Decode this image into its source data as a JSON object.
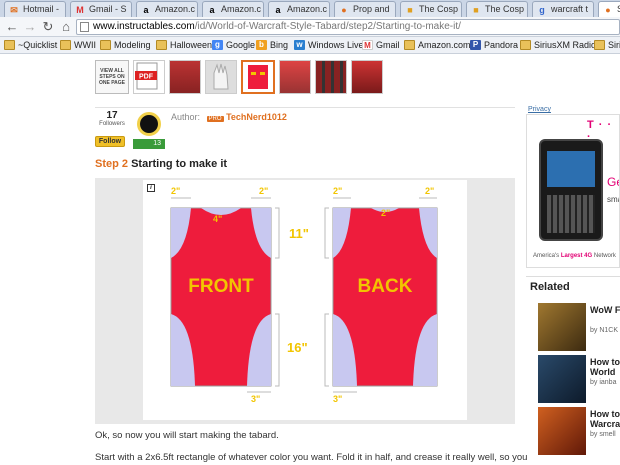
{
  "browser": {
    "tabs": [
      {
        "label": "Hotmail - ",
        "icon": "hotmail-icon"
      },
      {
        "label": "Gmail - S",
        "icon": "gmail-icon"
      },
      {
        "label": "Amazon.c",
        "icon": "amazon-icon"
      },
      {
        "label": "Amazon.c",
        "icon": "amazon-icon"
      },
      {
        "label": "Amazon.c",
        "icon": "amazon-icon"
      },
      {
        "label": "Prop and",
        "icon": "instructables-icon"
      },
      {
        "label": "The Cosp",
        "icon": "cosplay-icon"
      },
      {
        "label": "The Cosp",
        "icon": "cosplay-icon"
      },
      {
        "label": "warcraft t",
        "icon": "search-icon"
      },
      {
        "label": "St",
        "icon": "instructables-icon"
      }
    ],
    "url_host": "www.instructables.com",
    "url_path": "/id/World-of-Warcraft-Style-Tabard/step2/Starting-to-make-it/",
    "bookmarks": [
      "~Quicklist",
      "WWII",
      "Modeling",
      "Halloween",
      "Google",
      "Bing",
      "Windows Live",
      "Gmail",
      "Amazon.com",
      "Pandora",
      "SiriusXM Radio",
      "Siriu"
    ]
  },
  "steps_nav": {
    "view_all": "VIEW ALL STEPS ON ONE PAGE",
    "pdf_label": "PDF"
  },
  "author": {
    "followers_count": "17",
    "followers_label": "Followers",
    "follow_button": "Follow",
    "badge_count": "13",
    "author_label": "Author:",
    "pro_label": "PRO",
    "name": "TechNerd1012"
  },
  "step": {
    "number": "Step 2",
    "title": "Starting to make it"
  },
  "diagram": {
    "front_label": "FRONT",
    "back_label": "BACK",
    "dim_top_left": "2\"",
    "dim_top_right": "2\"",
    "dim_top_back_left": "2\"",
    "dim_top_back_right": "2\"",
    "dim_neck": "4\"",
    "dim_neck_back": "2\"",
    "dim_upper": "11\"",
    "dim_lower": "16\"",
    "dim_bottom": "3\"",
    "dim_bottom_back": "3\""
  },
  "body_text": {
    "p1": "Ok, so now you will start making the tabard.",
    "p2": "Start with a 2x6.5ft rectangle of whatever color you want. Fold it in half, and crease it really well, so you"
  },
  "sidebar": {
    "ad_label": "Privacy",
    "ad_brand": "T · · ·",
    "ad_get": "Ge",
    "ad_small": "sma",
    "ad_tagline_pre": "America's",
    "ad_tagline_bold": "Largest 4G",
    "ad_tagline_post": "Network",
    "related_heading": "Related",
    "related": [
      {
        "title1": "WoW F",
        "title2": "",
        "by": "by N1CK"
      },
      {
        "title1": "How to",
        "title2": "World",
        "by": "by ianba"
      },
      {
        "title1": "How to",
        "title2": "Warcra",
        "by": "by smell"
      }
    ]
  },
  "colors": {
    "accent_orange": "#e07020",
    "tabard_red": "#ee1c3c",
    "cutout_lavender": "#c8c8f0",
    "dim_yellow": "#f2c500",
    "tmobile_magenta": "#e20074"
  }
}
